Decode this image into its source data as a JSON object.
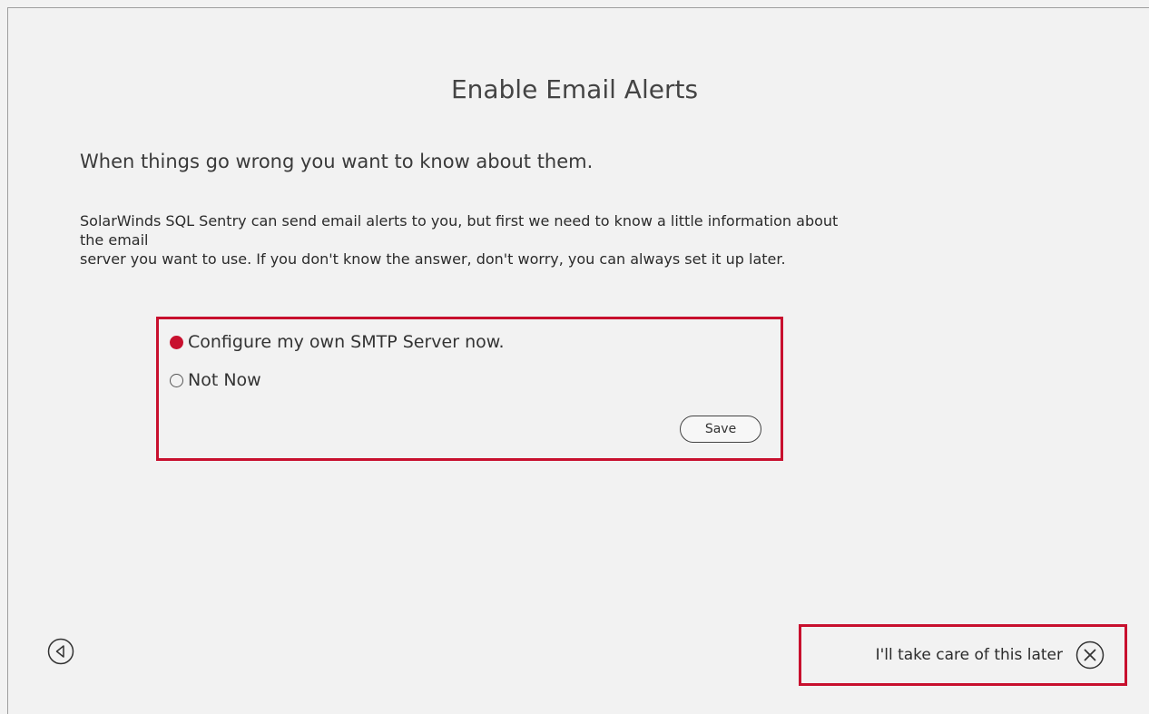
{
  "page": {
    "title": "Enable Email Alerts",
    "headline": "When things go wrong you want to know about them.",
    "description": [
      "SolarWinds SQL Sentry can send email alerts to you, but first we need to know a little information about",
      "the email",
      "server you want to use. If you don't know the answer, don't worry, you can always set it up later."
    ]
  },
  "options": [
    {
      "label": "Configure my own SMTP Server now.",
      "selected": true
    },
    {
      "label": "Not Now",
      "selected": false
    }
  ],
  "save_label": "Save",
  "footer": {
    "back_icon": "chevron-left-circle-icon",
    "later_label": "I'll take care of this later",
    "close_icon": "close-circle-icon"
  },
  "colors": {
    "accent": "#c8102e",
    "background": "#f2f2f2"
  }
}
